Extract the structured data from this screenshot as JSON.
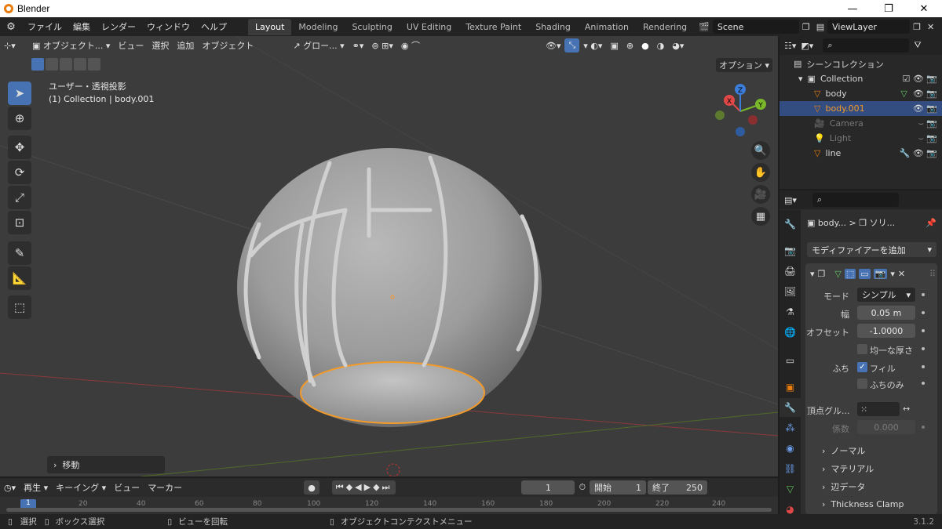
{
  "window": {
    "title": "Blender",
    "minimize": "—",
    "maximize": "❐",
    "close": "✕"
  },
  "menubar": {
    "items": [
      "ファイル",
      "編集",
      "レンダー",
      "ウィンドウ",
      "ヘルプ"
    ],
    "workspaces": [
      "Layout",
      "Modeling",
      "Sculpting",
      "UV Editing",
      "Texture Paint",
      "Shading",
      "Animation",
      "Rendering"
    ],
    "scene": "Scene",
    "view_layer": "ViewLayer"
  },
  "viewport": {
    "mode": "オブジェクト...",
    "menus": [
      "ビュー",
      "選択",
      "追加",
      "オブジェクト"
    ],
    "transform": "グロー...",
    "view_name": "ユーザー・透視投影",
    "collection_info": "(1) Collection | body.001",
    "options": "オプション",
    "last_op": "移動",
    "gizmo": {
      "x": "X",
      "y": "Y",
      "z": "Z"
    }
  },
  "timeline": {
    "menus": [
      "再生",
      "キーイング",
      "ビュー",
      "マーカー"
    ],
    "current_frame": "1",
    "start_label": "開始",
    "start": "1",
    "end_label": "終了",
    "end": "250",
    "ruler": [
      "1",
      "20",
      "40",
      "60",
      "80",
      "100",
      "120",
      "140",
      "160",
      "180",
      "200",
      "220",
      "240"
    ]
  },
  "status": {
    "select": "選択",
    "box_select": "ボックス選択",
    "rotate_view": "ビューを回転",
    "context_menu": "オブジェクトコンテクストメニュー",
    "version": "3.1.2"
  },
  "outliner": {
    "scene_collection": "シーンコレクション",
    "items": [
      {
        "name": "Collection",
        "level": 0
      },
      {
        "name": "body",
        "level": 1
      },
      {
        "name": "body.001",
        "level": 1,
        "selected": true
      },
      {
        "name": "Camera",
        "level": 1,
        "disabled": true
      },
      {
        "name": "Light",
        "level": 1,
        "disabled": true
      },
      {
        "name": "line",
        "level": 1
      }
    ]
  },
  "properties": {
    "breadcrumb_object": "body...",
    "breadcrumb_modifier": "ソリ...",
    "add_modifier": "モディファイアーを追加",
    "mode_label": "モード",
    "mode_value": "シンプル",
    "width_label": "幅",
    "width_value": "0.05 m",
    "offset_label": "オフセット",
    "offset_value": "-1.0000",
    "even_thickness": "均一な厚さ",
    "rim_label": "ふち",
    "fill": "フィル",
    "rim_only": "ふちのみ",
    "vgroup_label": "頂点グル...",
    "factor_label": "係数",
    "factor_value": "0.000",
    "panels": [
      "ノーマル",
      "マテリアル",
      "辺データ",
      "Thickness Clamp"
    ]
  },
  "colors": {
    "accent": "#4772b3",
    "selection": "#f39a28",
    "header": "#232323",
    "viewport": "#3c3c3c"
  }
}
